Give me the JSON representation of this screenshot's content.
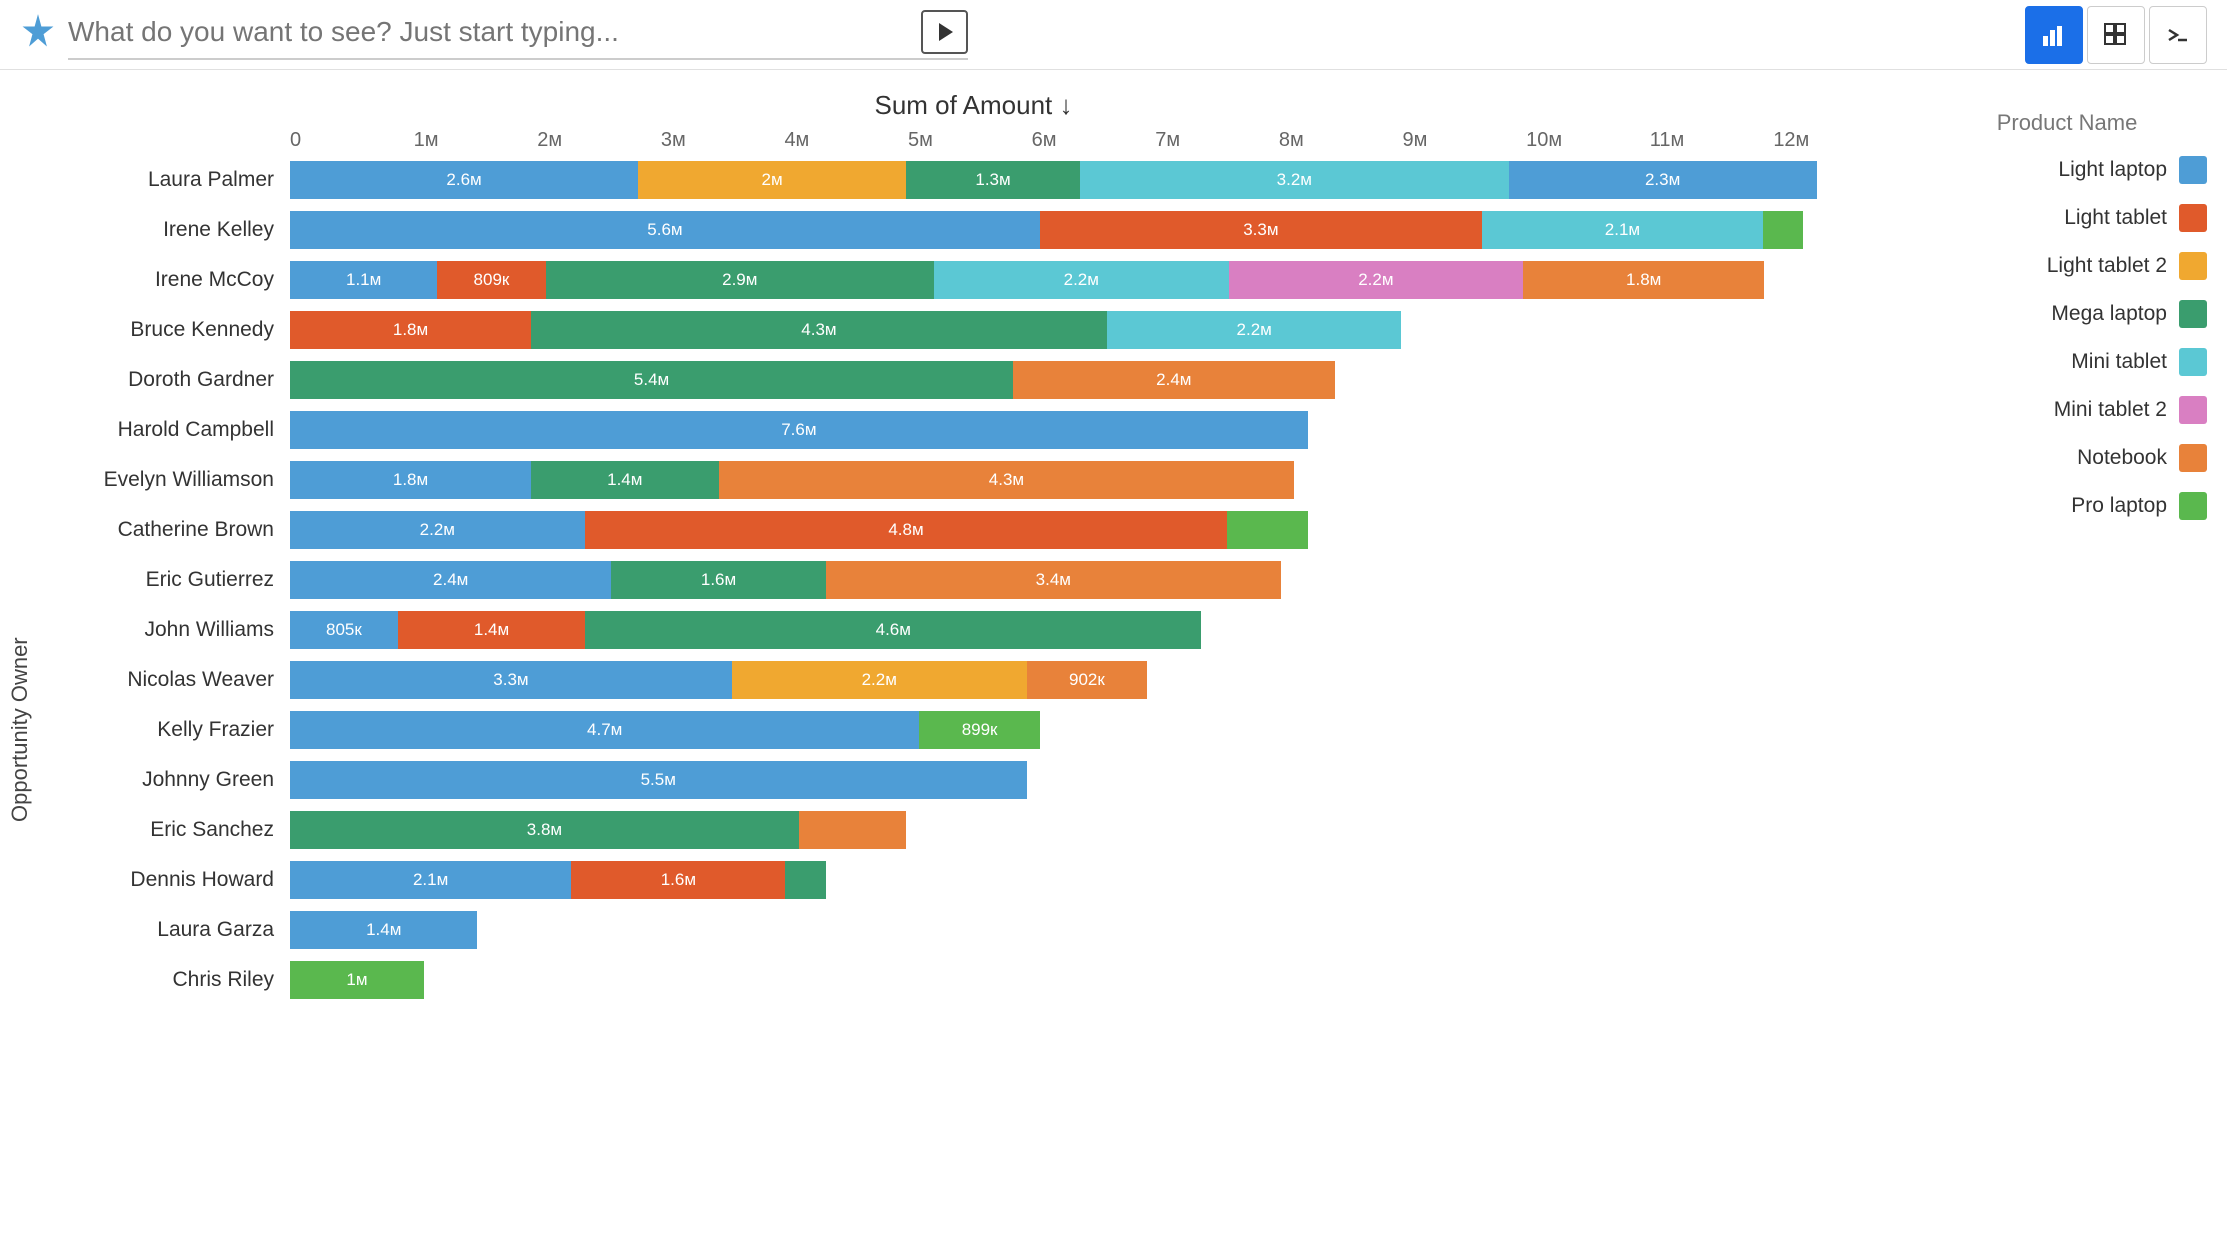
{
  "topbar": {
    "search_placeholder": "What do you want to see? Just start typing...",
    "btn_chart_label": "⠿",
    "btn_grid_label": "⊞",
    "btn_terminal_label": ">"
  },
  "chart": {
    "title": "Sum of Amount ↓",
    "y_axis_label": "Opportunity Owner",
    "x_ticks": [
      "0",
      "1м",
      "2м",
      "3м",
      "4м",
      "5м",
      "6м",
      "7м",
      "8м",
      "9м",
      "10м",
      "11м",
      "12м"
    ],
    "max_value": 12,
    "legend": {
      "title": "Product Name",
      "items": [
        {
          "label": "Light laptop",
          "color_class": "c-light-laptop"
        },
        {
          "label": "Light tablet",
          "color_class": "c-light-tablet"
        },
        {
          "label": "Light tablet 2",
          "color_class": "c-light-tablet2"
        },
        {
          "label": "Mega laptop",
          "color_class": "c-mega-laptop"
        },
        {
          "label": "Mini tablet",
          "color_class": "c-mini-tablet"
        },
        {
          "label": "Mini tablet 2",
          "color_class": "c-mini-tablet2"
        },
        {
          "label": "Notebook",
          "color_class": "c-notebook"
        },
        {
          "label": "Pro laptop",
          "color_class": "c-pro-laptop"
        }
      ]
    },
    "rows": [
      {
        "name": "Laura Palmer",
        "segments": [
          {
            "value": 2.6,
            "label": "2.6м",
            "color_class": "c-light-laptop"
          },
          {
            "value": 2.0,
            "label": "2м",
            "color_class": "c-light-tablet2"
          },
          {
            "value": 1.3,
            "label": "1.3м",
            "color_class": "c-mega-laptop"
          },
          {
            "value": 3.2,
            "label": "3.2м",
            "color_class": "c-mini-tablet"
          },
          {
            "value": 2.3,
            "label": "2.3м",
            "color_class": "c-light-laptop"
          }
        ]
      },
      {
        "name": "Irene Kelley",
        "segments": [
          {
            "value": 5.6,
            "label": "5.6м",
            "color_class": "c-light-laptop"
          },
          {
            "value": 3.3,
            "label": "3.3м",
            "color_class": "c-light-tablet"
          },
          {
            "value": 2.1,
            "label": "2.1м",
            "color_class": "c-mini-tablet"
          },
          {
            "value": 0.3,
            "label": "",
            "color_class": "c-pro-laptop"
          }
        ]
      },
      {
        "name": "Irene McCoy",
        "segments": [
          {
            "value": 1.1,
            "label": "1.1м",
            "color_class": "c-light-laptop"
          },
          {
            "value": 0.809,
            "label": "809к",
            "color_class": "c-light-tablet"
          },
          {
            "value": 2.9,
            "label": "2.9м",
            "color_class": "c-mega-laptop"
          },
          {
            "value": 2.2,
            "label": "2.2м",
            "color_class": "c-mini-tablet"
          },
          {
            "value": 2.2,
            "label": "2.2м",
            "color_class": "c-mini-tablet2"
          },
          {
            "value": 1.8,
            "label": "1.8м",
            "color_class": "c-notebook"
          }
        ]
      },
      {
        "name": "Bruce Kennedy",
        "segments": [
          {
            "value": 1.8,
            "label": "1.8м",
            "color_class": "c-light-tablet"
          },
          {
            "value": 4.3,
            "label": "4.3м",
            "color_class": "c-mega-laptop"
          },
          {
            "value": 2.2,
            "label": "2.2м",
            "color_class": "c-mini-tablet"
          }
        ]
      },
      {
        "name": "Doroth Gardner",
        "segments": [
          {
            "value": 5.4,
            "label": "5.4м",
            "color_class": "c-mega-laptop"
          },
          {
            "value": 2.4,
            "label": "2.4м",
            "color_class": "c-notebook"
          }
        ]
      },
      {
        "name": "Harold Campbell",
        "segments": [
          {
            "value": 7.6,
            "label": "7.6м",
            "color_class": "c-light-laptop"
          }
        ]
      },
      {
        "name": "Evelyn Williamson",
        "segments": [
          {
            "value": 1.8,
            "label": "1.8м",
            "color_class": "c-light-laptop"
          },
          {
            "value": 1.4,
            "label": "1.4м",
            "color_class": "c-mega-laptop"
          },
          {
            "value": 4.3,
            "label": "4.3м",
            "color_class": "c-notebook"
          }
        ]
      },
      {
        "name": "Catherine Brown",
        "segments": [
          {
            "value": 2.2,
            "label": "2.2м",
            "color_class": "c-light-laptop"
          },
          {
            "value": 4.8,
            "label": "4.8м",
            "color_class": "c-light-tablet"
          },
          {
            "value": 0.6,
            "label": "",
            "color_class": "c-pro-laptop"
          }
        ]
      },
      {
        "name": "Eric Gutierrez",
        "segments": [
          {
            "value": 2.4,
            "label": "2.4м",
            "color_class": "c-light-laptop"
          },
          {
            "value": 1.6,
            "label": "1.6м",
            "color_class": "c-mega-laptop"
          },
          {
            "value": 3.4,
            "label": "3.4м",
            "color_class": "c-notebook"
          }
        ]
      },
      {
        "name": "John Williams",
        "segments": [
          {
            "value": 0.805,
            "label": "805к",
            "color_class": "c-light-laptop"
          },
          {
            "value": 1.4,
            "label": "1.4м",
            "color_class": "c-light-tablet"
          },
          {
            "value": 4.6,
            "label": "4.6м",
            "color_class": "c-mega-laptop"
          }
        ]
      },
      {
        "name": "Nicolas Weaver",
        "segments": [
          {
            "value": 3.3,
            "label": "3.3м",
            "color_class": "c-light-laptop"
          },
          {
            "value": 2.2,
            "label": "2.2м",
            "color_class": "c-light-tablet2"
          },
          {
            "value": 0.902,
            "label": "902к",
            "color_class": "c-notebook"
          }
        ]
      },
      {
        "name": "Kelly Frazier",
        "segments": [
          {
            "value": 4.7,
            "label": "4.7м",
            "color_class": "c-light-laptop"
          },
          {
            "value": 0.899,
            "label": "899к",
            "color_class": "c-pro-laptop"
          }
        ]
      },
      {
        "name": "Johnny Green",
        "segments": [
          {
            "value": 5.5,
            "label": "5.5м",
            "color_class": "c-light-laptop"
          }
        ]
      },
      {
        "name": "Eric Sanchez",
        "segments": [
          {
            "value": 3.8,
            "label": "3.8м",
            "color_class": "c-mega-laptop"
          },
          {
            "value": 0.8,
            "label": "",
            "color_class": "c-notebook"
          }
        ]
      },
      {
        "name": "Dennis Howard",
        "segments": [
          {
            "value": 2.1,
            "label": "2.1м",
            "color_class": "c-light-laptop"
          },
          {
            "value": 1.6,
            "label": "1.6м",
            "color_class": "c-light-tablet"
          },
          {
            "value": 0.3,
            "label": "",
            "color_class": "c-mega-laptop"
          }
        ]
      },
      {
        "name": "Laura Garza",
        "segments": [
          {
            "value": 1.4,
            "label": "1.4м",
            "color_class": "c-light-laptop"
          }
        ]
      },
      {
        "name": "Chris Riley",
        "segments": [
          {
            "value": 1.0,
            "label": "1м",
            "color_class": "c-pro-laptop"
          }
        ]
      }
    ]
  }
}
